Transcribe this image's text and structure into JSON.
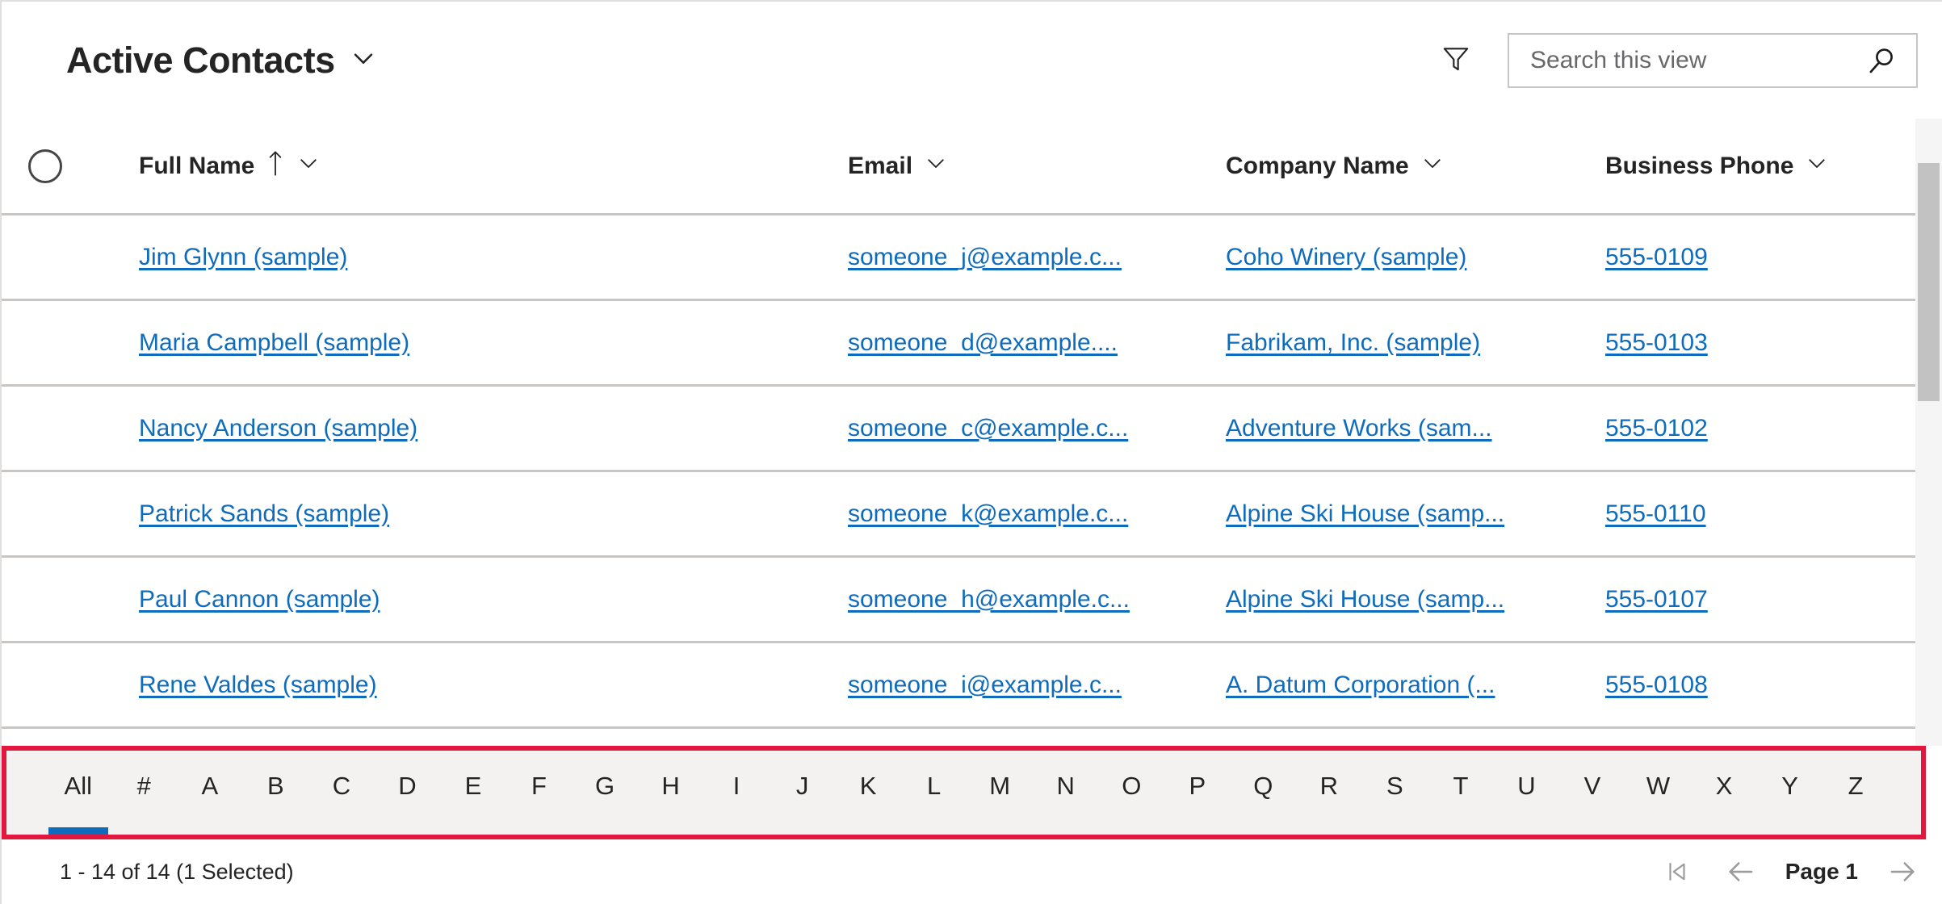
{
  "header": {
    "view_title": "Active Contacts",
    "view_chevron_icon": "chevron-down-icon",
    "filter_icon": "filter-funnel-icon",
    "search": {
      "placeholder": "Search this view",
      "value": "",
      "icon": "search-icon"
    }
  },
  "grid": {
    "select_all_icon": "circle-checkbox-icon",
    "columns": [
      {
        "label": "Full Name",
        "sort": "ascending",
        "sort_icon": "arrow-up-icon",
        "menu_icon": "chevron-down-icon"
      },
      {
        "label": "Email",
        "sort": "none",
        "menu_icon": "chevron-down-icon"
      },
      {
        "label": "Company Name",
        "sort": "none",
        "menu_icon": "chevron-down-icon"
      },
      {
        "label": "Business Phone",
        "sort": "none",
        "menu_icon": "chevron-down-icon"
      }
    ],
    "rows": [
      {
        "full_name": "Jim Glynn (sample)",
        "email": "someone_j@example.c...",
        "company_name": "Coho Winery (sample)",
        "business_phone": "555-0109"
      },
      {
        "full_name": "Maria Campbell (sample)",
        "email": "someone_d@example....",
        "company_name": "Fabrikam, Inc. (sample)",
        "business_phone": "555-0103"
      },
      {
        "full_name": "Nancy Anderson (sample)",
        "email": "someone_c@example.c...",
        "company_name": "Adventure Works (sam...",
        "business_phone": "555-0102"
      },
      {
        "full_name": "Patrick Sands (sample)",
        "email": "someone_k@example.c...",
        "company_name": "Alpine Ski House (samp...",
        "business_phone": "555-0110"
      },
      {
        "full_name": "Paul Cannon (sample)",
        "email": "someone_h@example.c...",
        "company_name": "Alpine Ski House (samp...",
        "business_phone": "555-0107"
      },
      {
        "full_name": "Rene Valdes (sample)",
        "email": "someone_i@example.c...",
        "company_name": "A. Datum Corporation (...",
        "business_phone": "555-0108"
      }
    ]
  },
  "alphabet_filter": {
    "highlighted": true,
    "highlight_color": "#e3173e",
    "selected": "All",
    "selected_accent_color": "#0f6cbd",
    "items": [
      "All",
      "#",
      "A",
      "B",
      "C",
      "D",
      "E",
      "F",
      "G",
      "H",
      "I",
      "J",
      "K",
      "L",
      "M",
      "N",
      "O",
      "P",
      "Q",
      "R",
      "S",
      "T",
      "U",
      "V",
      "W",
      "X",
      "Y",
      "Z"
    ]
  },
  "footer": {
    "record_count": "1 - 14 of 14 (1 Selected)",
    "page_label": "Page 1",
    "first_page_icon": "first-page-icon",
    "previous_page_icon": "arrow-left-icon",
    "next_page_icon": "arrow-right-icon"
  },
  "colors": {
    "link": "#0f6cbd",
    "text": "#242424",
    "border": "#c8c6c4",
    "alpha_bar_bg": "#f3f2f1",
    "highlight": "#e3173e"
  }
}
